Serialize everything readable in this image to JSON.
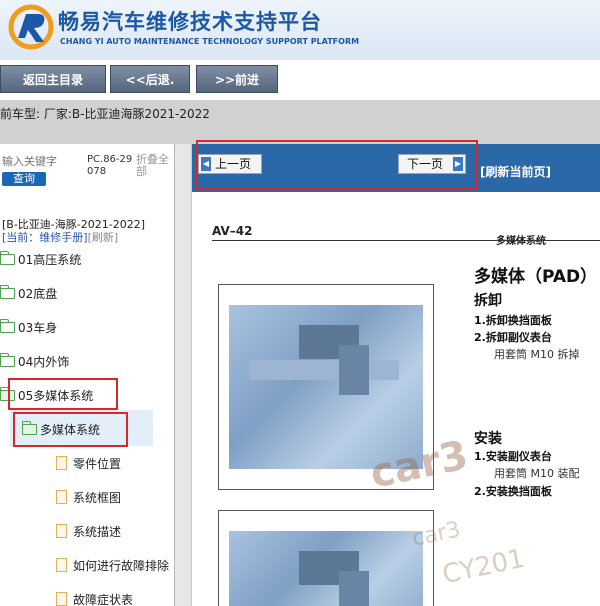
{
  "header": {
    "title_cn": "畅易汽车维修技术支持平台",
    "title_en": "CHANG YI AUTO MAINTENANCE TECHNOLOGY SUPPORT PLATFORM"
  },
  "toolbar": {
    "home": "返回主目录",
    "back": "<<后退.",
    "forward": ">>前进"
  },
  "model_bar": {
    "text": "前车型:  厂家:B-比亚迪海豚2021-2022"
  },
  "sidebar": {
    "search_placeholder": "输入关键字",
    "search_button": "查询",
    "pc_code": "PC.86-29078",
    "collapse_all": "折叠全部",
    "current_model": "[B-比亚迪-海豚-2021-2022]",
    "current_manual": "[当前：维修手册]",
    "refresh": "[刷新]",
    "tree": [
      {
        "label": "01高压系统"
      },
      {
        "label": "02底盘"
      },
      {
        "label": "03车身"
      },
      {
        "label": "04内外饰"
      },
      {
        "label": "05多媒体系统"
      },
      {
        "label": "多媒体系统"
      },
      {
        "label": "零件位置"
      },
      {
        "label": "系统框图"
      },
      {
        "label": "系统描述"
      },
      {
        "label": "如何进行故障排除"
      },
      {
        "label": "故障症状表"
      }
    ]
  },
  "content": {
    "prev_page": "上一页",
    "next_page": "下一页",
    "refresh_page": "[刷新当前页]",
    "doc": {
      "page_code": "AV–42",
      "system_small": "多媒体系统",
      "heading": "多媒体（PAD）",
      "remove_title": "拆卸",
      "remove_step1": "1.拆卸换挡面板",
      "remove_step2": "2.拆卸副仪表台",
      "remove_note": "用套筒 M10 拆掉",
      "install_title": "安装",
      "install_step1": "1.安装副仪表台",
      "install_note": "用套筒 M10 装配",
      "install_step2": "2.安装换挡面板"
    },
    "watermark": {
      "main": "car3",
      "line2": "car3",
      "line3": "CY201"
    }
  }
}
